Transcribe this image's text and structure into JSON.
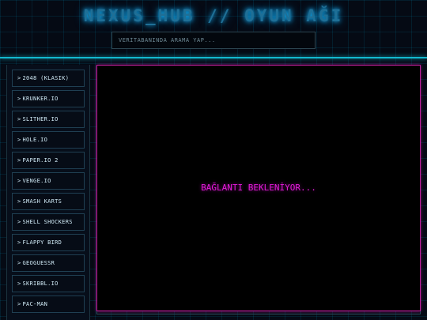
{
  "header": {
    "title": "NEXUS_HUB // OYUN AĞI",
    "search_placeholder": "VERİTABANINDA ARAMA YAP..."
  },
  "sidebar": {
    "items": [
      {
        "label": "2048 (KLASIK)"
      },
      {
        "label": "KRUNKER.IO"
      },
      {
        "label": "SLITHER.IO"
      },
      {
        "label": "HOLE.IO"
      },
      {
        "label": "PAPER.IO 2"
      },
      {
        "label": "VENGE.IO"
      },
      {
        "label": "SMASH KARTS"
      },
      {
        "label": "SHELL SHOCKERS"
      },
      {
        "label": "FLAPPY BIRD"
      },
      {
        "label": "GEOGUESSR"
      },
      {
        "label": "SKRIBBL.IO"
      },
      {
        "label": "PAC-MAN"
      }
    ],
    "arrow": ">"
  },
  "viewport": {
    "status": "BAĞLANTI BEKLENİYOR..."
  },
  "colors": {
    "accent_cyan": "#13b9cf",
    "accent_magenta": "#e21ad8",
    "background": "#050a14"
  }
}
